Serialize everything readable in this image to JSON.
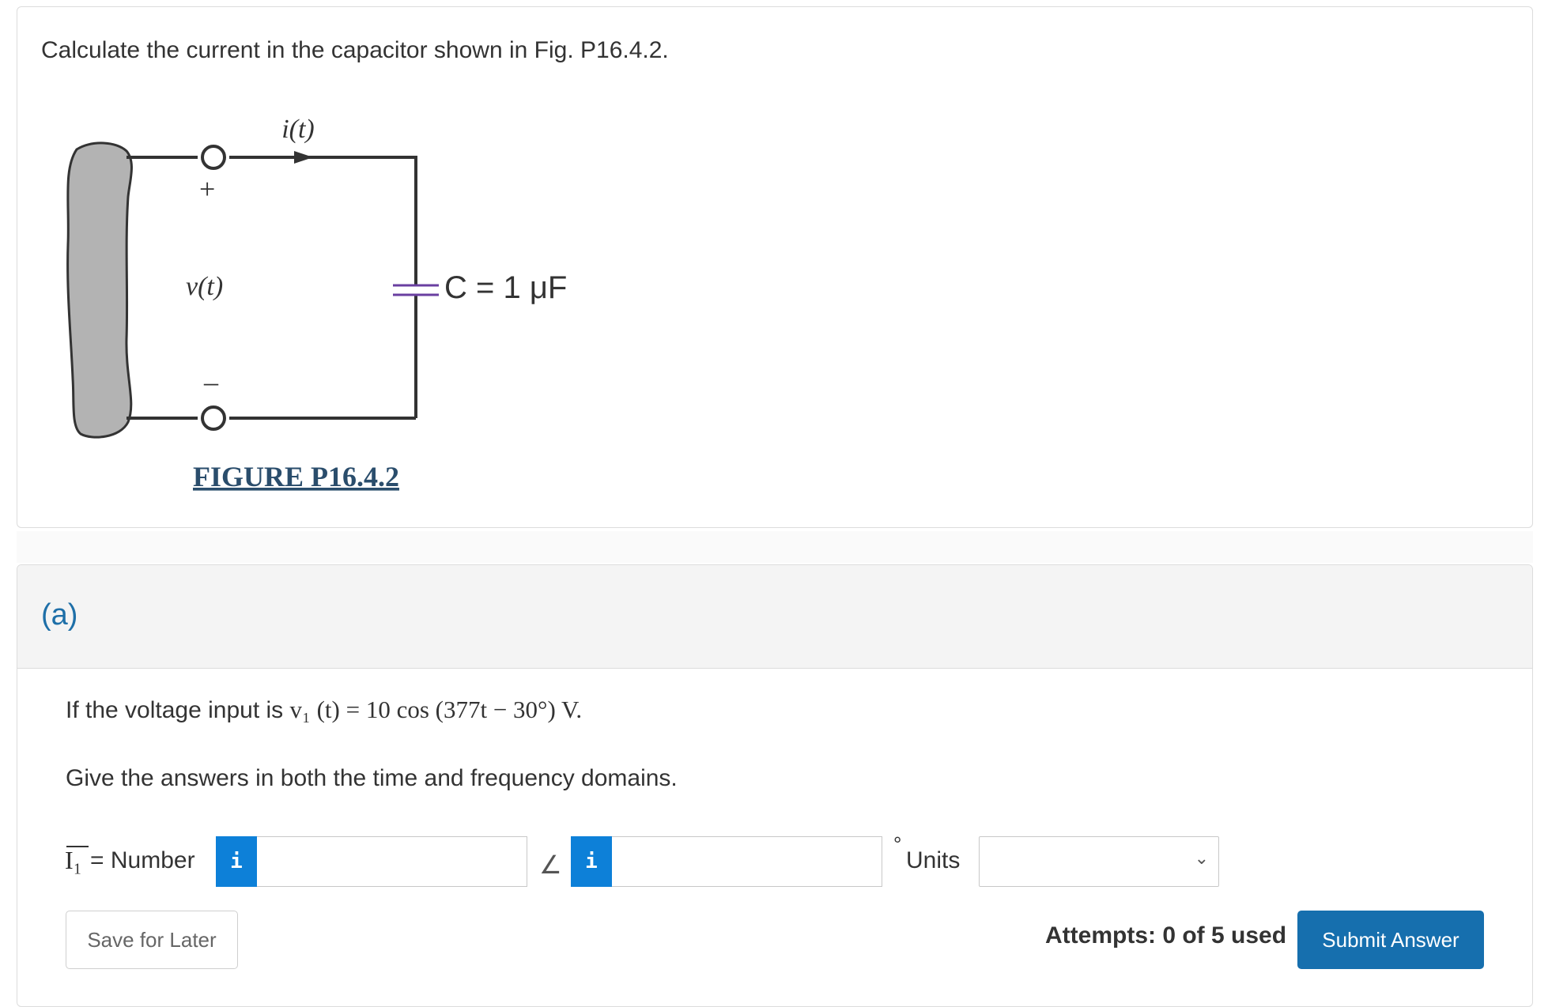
{
  "question": {
    "text": "Calculate the current in the capacitor shown in Fig. P16.4.2."
  },
  "figure": {
    "current_label": "i(t)",
    "voltage_label": "v(t)",
    "plus_sign": "+",
    "minus_sign": "–",
    "capacitor_label": "C = 1 μF",
    "caption": "FIGURE P16.4.2"
  },
  "part_a": {
    "label": "(a)",
    "voltage_prefix": "If the voltage input is ",
    "voltage_expr": "v₁ (t)  =  10 cos (377t − 30°) V.",
    "instruction": "Give the answers in both the time and frequency domains.",
    "answer_var": "I₁",
    "equals_number": "= Number",
    "info_icon_glyph": "i",
    "angle_symbol": "∠",
    "degree_symbol": "°",
    "units_label": "Units",
    "units_selected": "",
    "magnitude_value": "",
    "angle_value": "",
    "save_label": "Save for Later",
    "attempts_text": "Attempts: 0 of 5 used",
    "submit_label": "Submit Answer"
  },
  "colors": {
    "accent_blue": "#0d80d8",
    "submit_blue": "#166fae",
    "link_teal": "#1e6fa8",
    "capacitor_purple": "#6a3fa0",
    "source_gray": "#b3b3b3"
  },
  "icons": {
    "info": "info-icon",
    "dropdown": "chevron-down-icon",
    "angle": "angle-icon"
  }
}
